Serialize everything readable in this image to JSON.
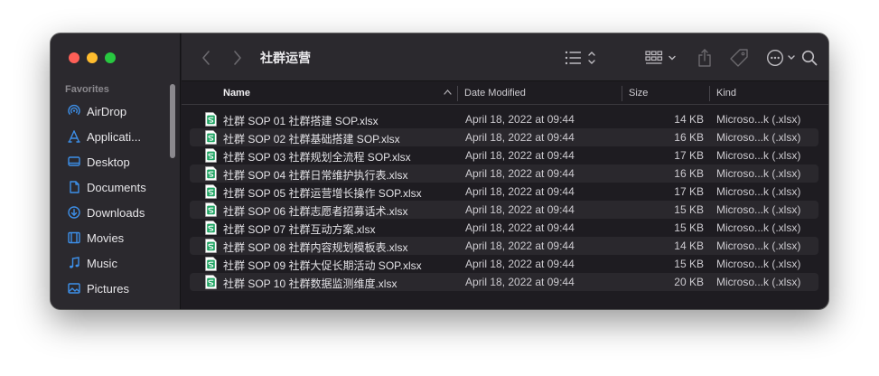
{
  "window": {
    "title": "社群运营"
  },
  "colors": {
    "close": "#fe5f57",
    "minimize": "#febc2e",
    "zoom": "#28c840",
    "excel_green": "#1fa463",
    "sidebar_icon": "#3d8fe8"
  },
  "sidebar": {
    "section": "Favorites",
    "items": [
      {
        "label": "AirDrop",
        "icon": "airdrop-icon"
      },
      {
        "label": "Applicati...",
        "icon": "applications-icon"
      },
      {
        "label": "Desktop",
        "icon": "desktop-icon"
      },
      {
        "label": "Documents",
        "icon": "document-icon"
      },
      {
        "label": "Downloads",
        "icon": "downloads-icon"
      },
      {
        "label": "Movies",
        "icon": "movies-icon"
      },
      {
        "label": "Music",
        "icon": "music-icon"
      },
      {
        "label": "Pictures",
        "icon": "pictures-icon"
      }
    ]
  },
  "columns": {
    "name": "Name",
    "date": "Date Modified",
    "size": "Size",
    "kind": "Kind"
  },
  "files": [
    {
      "name": "社群 SOP 01 社群搭建 SOP.xlsx",
      "date": "April 18, 2022 at 09:44",
      "size": "14 KB",
      "kind": "Microso...k (.xlsx)"
    },
    {
      "name": "社群 SOP 02 社群基础搭建 SOP.xlsx",
      "date": "April 18, 2022 at 09:44",
      "size": "16 KB",
      "kind": "Microso...k (.xlsx)"
    },
    {
      "name": "社群 SOP 03 社群规划全流程 SOP.xlsx",
      "date": "April 18, 2022 at 09:44",
      "size": "17 KB",
      "kind": "Microso...k (.xlsx)"
    },
    {
      "name": "社群 SOP 04  社群日常维护执行表.xlsx",
      "date": "April 18, 2022 at 09:44",
      "size": "16 KB",
      "kind": "Microso...k (.xlsx)"
    },
    {
      "name": "社群 SOP 05 社群运营增长操作 SOP.xlsx",
      "date": "April 18, 2022 at 09:44",
      "size": "17 KB",
      "kind": "Microso...k (.xlsx)"
    },
    {
      "name": "社群 SOP 06 社群志愿者招募话术.xlsx",
      "date": "April 18, 2022 at 09:44",
      "size": "15 KB",
      "kind": "Microso...k (.xlsx)"
    },
    {
      "name": "社群 SOP 07 社群互动方案.xlsx",
      "date": "April 18, 2022 at 09:44",
      "size": "15 KB",
      "kind": "Microso...k (.xlsx)"
    },
    {
      "name": "社群 SOP 08 社群内容规划模板表.xlsx",
      "date": "April 18, 2022 at 09:44",
      "size": "14 KB",
      "kind": "Microso...k (.xlsx)"
    },
    {
      "name": "社群 SOP 09 社群大促长期活动 SOP.xlsx",
      "date": "April 18, 2022 at 09:44",
      "size": "15 KB",
      "kind": "Microso...k (.xlsx)"
    },
    {
      "name": "社群 SOP 10 社群数据监测维度.xlsx",
      "date": "April 18, 2022 at 09:44",
      "size": "20 KB",
      "kind": "Microso...k (.xlsx)"
    }
  ]
}
